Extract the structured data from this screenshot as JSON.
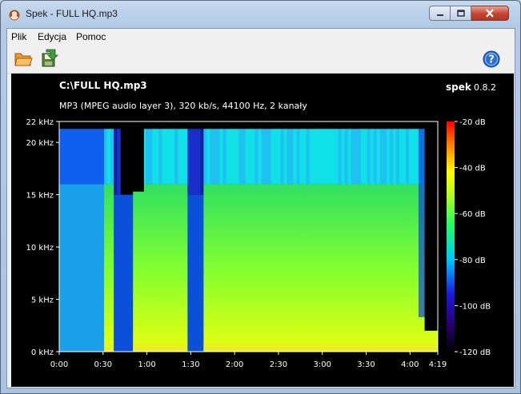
{
  "window": {
    "title": "Spek - FULL HQ.mp3"
  },
  "menu": {
    "items": [
      "Plik",
      "Edycja",
      "Pomoc"
    ]
  },
  "toolbar": {
    "icons": [
      "open-folder-icon",
      "save-icon",
      "help-icon"
    ]
  },
  "spectrogram": {
    "file_path": "C:\\FULL HQ.mp3",
    "app_name": "spek",
    "app_version": "0.8.2",
    "info": "MP3 (MPEG audio layer 3), 320 kb/s, 44100 Hz, 2 kanały"
  },
  "chart_data": {
    "type": "heatmap",
    "xlabel": "",
    "ylabel": "",
    "x_ticks": [
      "0:00",
      "0:30",
      "1:00",
      "1:30",
      "2:00",
      "2:30",
      "3:00",
      "3:30",
      "4:00",
      "4:19"
    ],
    "y_ticks": [
      "0 kHz",
      "5 kHz",
      "10 kHz",
      "15 kHz",
      "20 kHz",
      "22 kHz"
    ],
    "colorbar_ticks": [
      "-20 dB",
      "-40 dB",
      "-60 dB",
      "-80 dB",
      "-100 dB",
      "-120 dB"
    ],
    "x_range_seconds": [
      0,
      259
    ],
    "y_range_khz": [
      0,
      22
    ],
    "colorbar_range_db": [
      -120,
      -20
    ],
    "colors": [
      "#000000",
      "#3000a0",
      "#0040ff",
      "#00e0ff",
      "#40ff40",
      "#ffff00",
      "#ff8000",
      "#ff0000"
    ]
  }
}
